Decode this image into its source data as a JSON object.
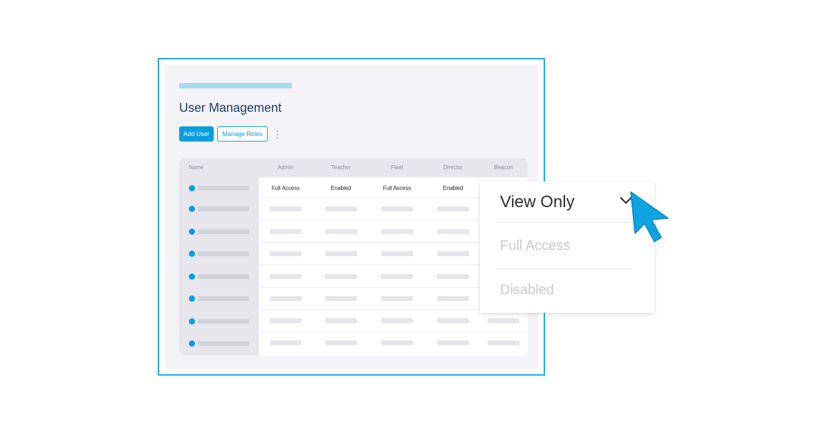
{
  "page": {
    "title": "User Management",
    "buttons": {
      "add_user": "Add User",
      "manage_roles": "Manage Roles"
    }
  },
  "table": {
    "columns": [
      "Name",
      "Admin",
      "Teacher",
      "Fleet",
      "Director",
      "Beacon"
    ],
    "first_row": [
      "Full Access",
      "Enabled",
      "Full Access",
      "Enabled"
    ]
  },
  "dropdown": {
    "selected": "View Only",
    "options": [
      "Full Access",
      "Disabled"
    ]
  },
  "colors": {
    "accent": "#0a9ee0",
    "frame": "#1ca7e8",
    "title": "#1c3a6e"
  },
  "icons": [
    "kebab-menu-icon",
    "chevron-down-icon",
    "mouse-pointer-icon",
    "user-status-icon"
  ]
}
